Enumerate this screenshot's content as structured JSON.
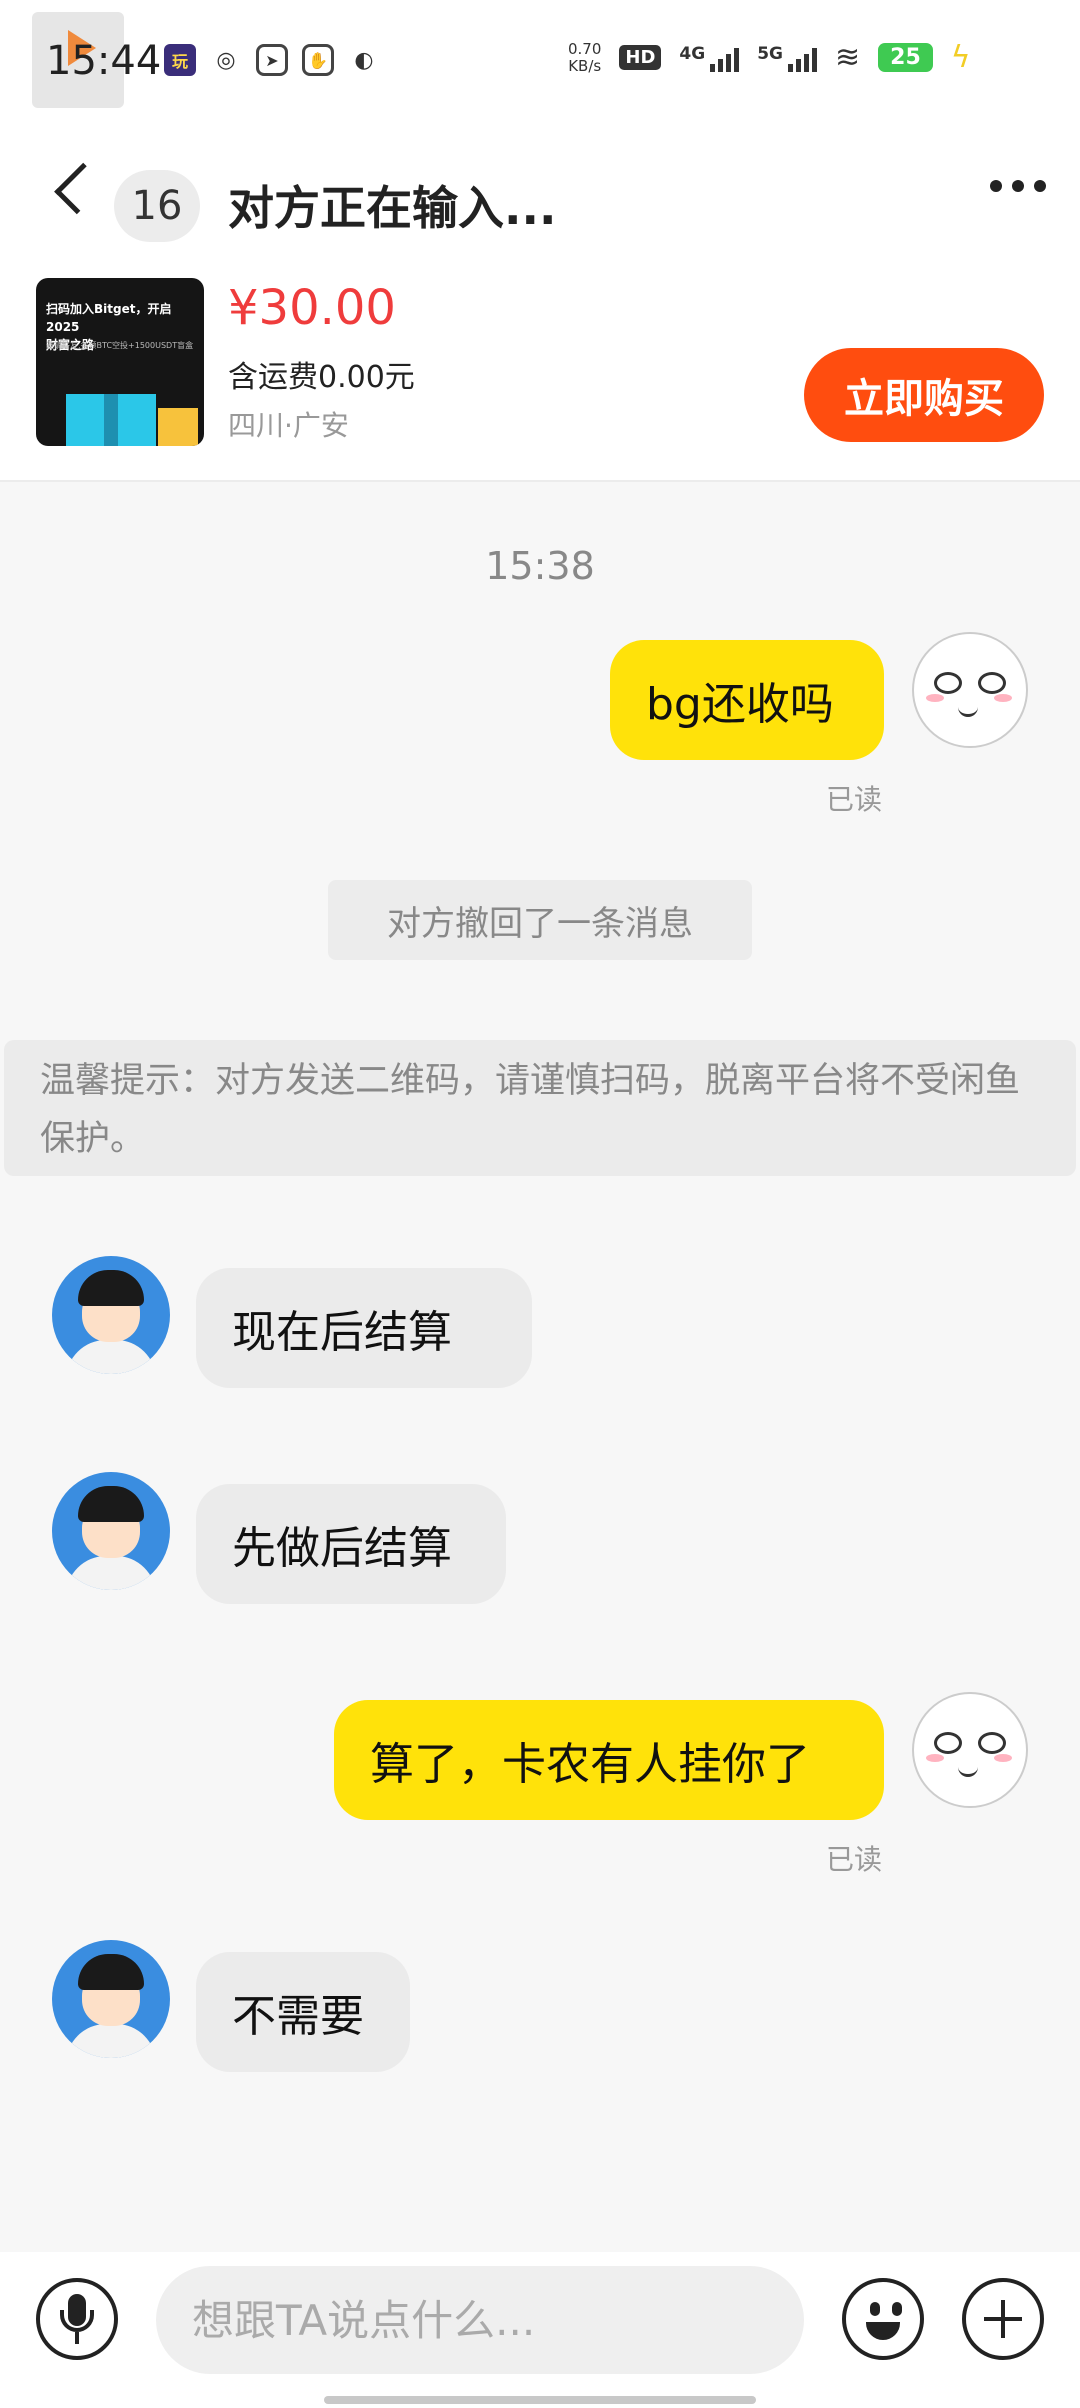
{
  "status_bar": {
    "time": "15:44",
    "net_speed_value": "0.70",
    "net_speed_unit": "KB/s",
    "hd_label": "HD",
    "sim1_label": "4G",
    "sim2_label": "5G",
    "battery_level": "25",
    "app_badge": "玩"
  },
  "header": {
    "unread_count": "16",
    "title": "对方正在输入..."
  },
  "product": {
    "thumb_title_line1": "扫码加入Bitget，开启2025",
    "thumb_title_line2": "财富之路",
    "thumb_sub": "邀请好友,各领BTC空投+1500USDT盲盒",
    "price": "¥30.00",
    "shipping": "含运费0.00元",
    "location": "四川·广安",
    "buy_label": "立即购买"
  },
  "chat": {
    "time_label": "15:38",
    "messages": [
      {
        "from": "me",
        "text": "bg还收吗",
        "status": "已读"
      },
      {
        "from": "system",
        "text": "对方撤回了一条消息"
      },
      {
        "from": "warning",
        "text": "温馨提示：对方发送二维码，请谨慎扫码，脱离平台将不受闲鱼保护。"
      },
      {
        "from": "them",
        "text": "现在后结算"
      },
      {
        "from": "them",
        "text": "先做后结算"
      },
      {
        "from": "me",
        "text": "算了，卡农有人挂你了",
        "status": "已读"
      },
      {
        "from": "them",
        "text": "不需要"
      }
    ]
  },
  "input_bar": {
    "placeholder": "想跟TA说点什么..."
  },
  "colors": {
    "my_bubble": "#ffe20a",
    "their_bubble": "#ebebeb",
    "price": "#ef3c3c",
    "buy_button": "#ff4d0f",
    "battery": "#3fca52"
  }
}
